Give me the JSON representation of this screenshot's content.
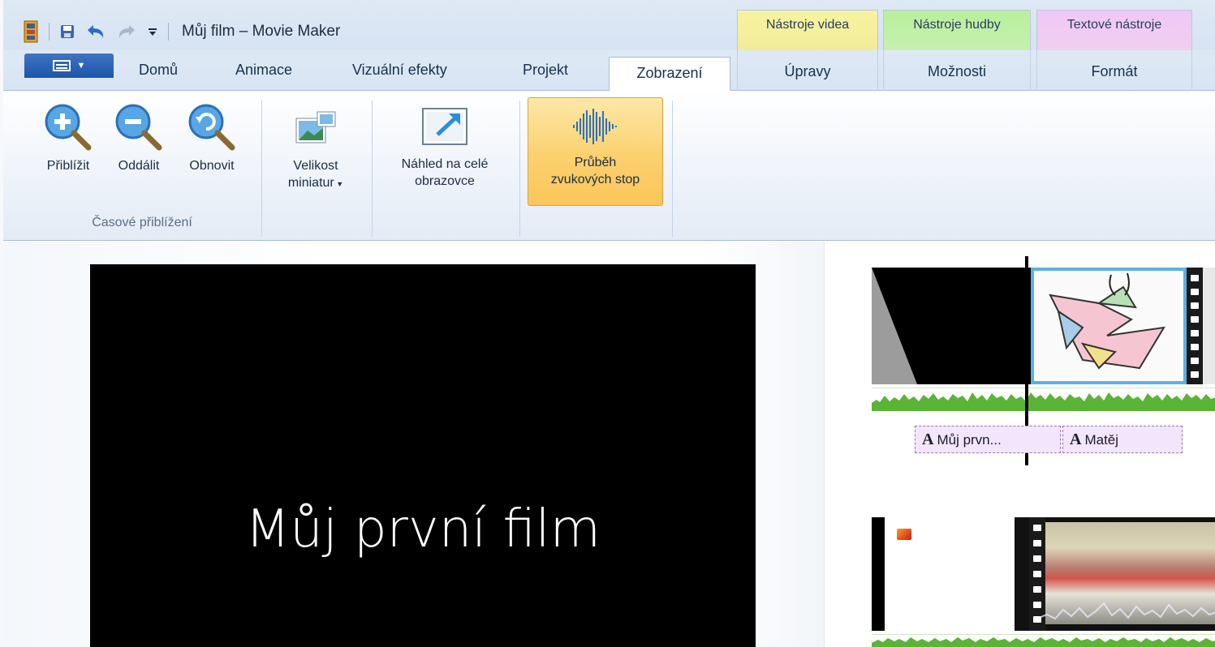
{
  "app": {
    "title": "Můj film – Movie Maker"
  },
  "colors": {
    "accent": "#1c56a8",
    "video_tools": "#f4ef9c",
    "music_tools": "#bfefa6",
    "text_tools": "#f0c9f4",
    "waveform": "#5ab435",
    "caption_bg": "#f3e5fb"
  },
  "quick_access": {
    "icons": [
      "movie-app-icon",
      "save-icon",
      "undo-icon",
      "redo-icon",
      "customize-dropdown-icon"
    ]
  },
  "contextual_groups": {
    "video_tools": "Nástroje videa",
    "music_tools": "Nástroje hudby",
    "text_tools": "Textové nástroje"
  },
  "tabs": {
    "home": "Domů",
    "animations": "Animace",
    "visual_effects": "Vizuální efekty",
    "project": "Projekt",
    "view": "Zobrazení",
    "edit": "Úpravy",
    "options": "Možnosti",
    "format": "Formát"
  },
  "active_tab": "Zobrazení",
  "ribbon": {
    "zoom_in": "Přiblížit",
    "zoom_out": "Oddálit",
    "reset": "Obnovit",
    "zoom_group_label": "Časové přiblížení",
    "thumb_size_line1": "Velikost",
    "thumb_size_line2": "miniatur",
    "fullscreen_line1": "Náhled na celé",
    "fullscreen_line2": "obrazovce",
    "waveform_line1": "Průběh",
    "waveform_line2": "zvukových stop"
  },
  "preview": {
    "text": "Můj první film"
  },
  "storyboard": {
    "captions": [
      "Můj prvn...",
      "Matěj"
    ],
    "caption_glyph": "A"
  }
}
